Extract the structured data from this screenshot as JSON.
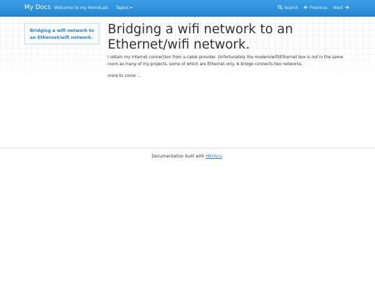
{
  "navbar": {
    "brand": "My Docs",
    "home_link": "Welcome to my HomeLab",
    "topics_label": "Topics",
    "search_label": "Search",
    "previous_label": "Previous",
    "next_label": "Next",
    "colors": {
      "bar": "#2d8ad6",
      "text": "#ffffff"
    },
    "icons": {
      "search": "search-icon",
      "previous": "arrow-left-icon",
      "next": "arrow-right-icon",
      "topics": "caret-down-icon"
    }
  },
  "toc": {
    "link_text": "Bridging a wifi network to an Ethernet/wifi network."
  },
  "main": {
    "title": "Bridging a wifi network to an Ethernet/wifi network.",
    "paragraph1": "I obtain my internet connection from a cable provider. Unfortunately the modem/wifi/Ethernet box is not in the same room as many of my projects, some of which are Ethernet only. A bridge connects two networks.",
    "paragraph2": "more to come ..."
  },
  "footer": {
    "text_before": "Documentation built with ",
    "link_text": "MkDocs",
    "text_after": "."
  }
}
